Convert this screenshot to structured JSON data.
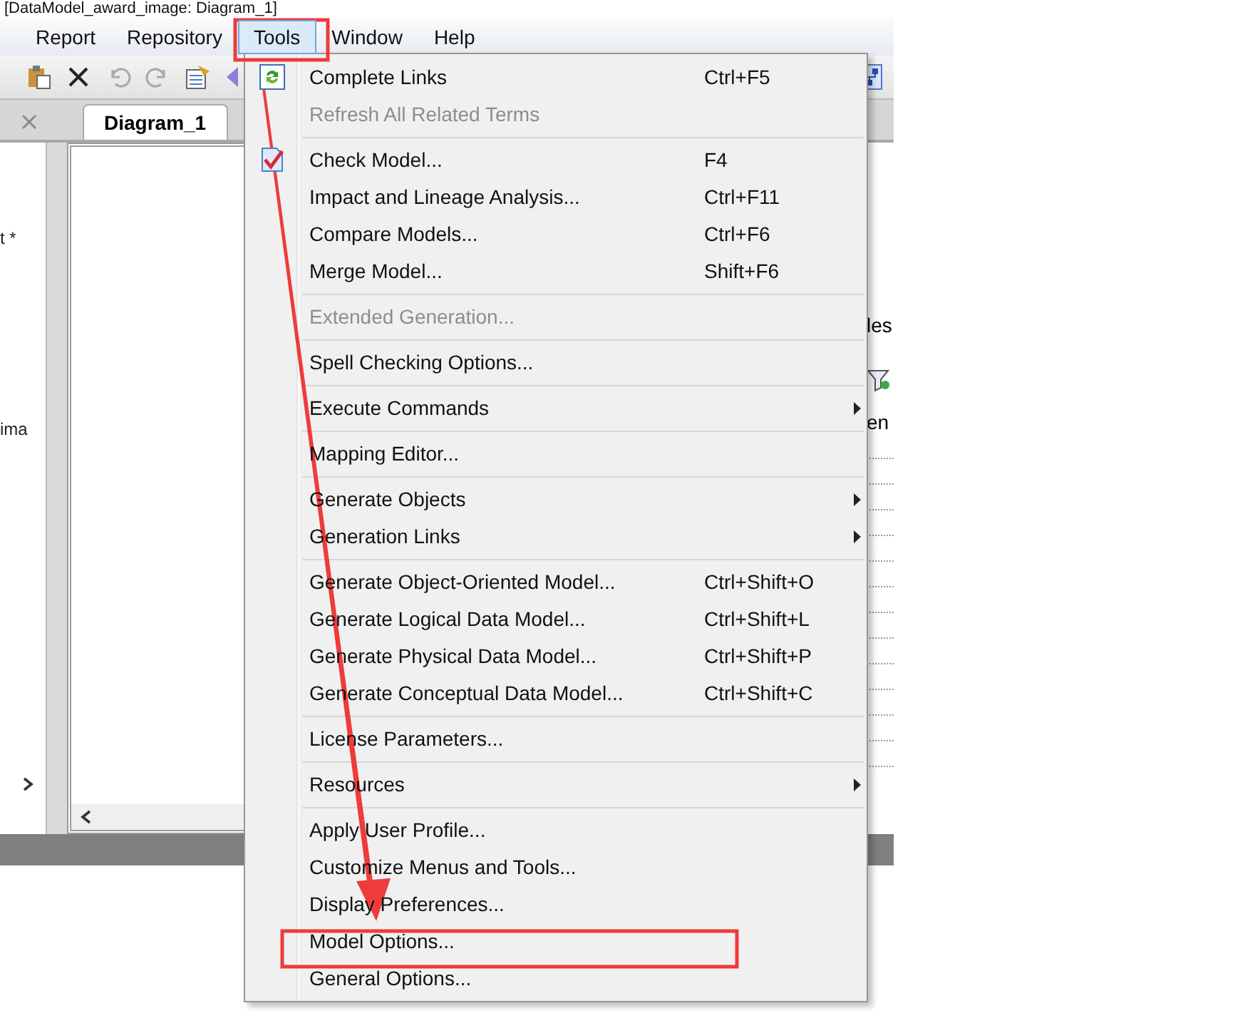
{
  "window": {
    "title": "[DataModel_award_image: Diagram_1]"
  },
  "menu_bar": [
    {
      "label": "Report",
      "selected": false
    },
    {
      "label": "Repository",
      "selected": false
    },
    {
      "label": "Tools",
      "selected": true
    },
    {
      "label": "Window",
      "selected": false
    },
    {
      "label": "Help",
      "selected": false
    }
  ],
  "tabs": [
    {
      "label": "Diagram_1",
      "selected": true
    }
  ],
  "browser_pane": {
    "items": [
      "t *",
      "ima"
    ]
  },
  "right_pane": {
    "texts": [
      "les",
      "en"
    ]
  },
  "tools_menu": {
    "items": [
      {
        "kind": "iconitem",
        "label": "Complete Links",
        "shortcut": "Ctrl+F5",
        "disabled": false,
        "submenu": false
      },
      {
        "kind": "item",
        "label": "Refresh All Related Terms",
        "disabled": true,
        "submenu": false
      },
      {
        "kind": "separator"
      },
      {
        "kind": "iconitem",
        "label": "Check Model...",
        "shortcut": "F4",
        "disabled": false,
        "submenu": false
      },
      {
        "kind": "item",
        "label": "Impact and Lineage Analysis...",
        "shortcut": "Ctrl+F11",
        "disabled": false,
        "submenu": false
      },
      {
        "kind": "item",
        "label": "Compare Models...",
        "shortcut": "Ctrl+F6",
        "disabled": false,
        "submenu": false
      },
      {
        "kind": "item",
        "label": "Merge Model...",
        "shortcut": "Shift+F6",
        "disabled": false,
        "submenu": false
      },
      {
        "kind": "separator"
      },
      {
        "kind": "item",
        "label": "Extended Generation...",
        "disabled": true,
        "submenu": false
      },
      {
        "kind": "separator"
      },
      {
        "kind": "item",
        "label": "Spell Checking Options...",
        "disabled": false,
        "submenu": false
      },
      {
        "kind": "separator"
      },
      {
        "kind": "item",
        "label": "Execute Commands",
        "disabled": false,
        "submenu": true
      },
      {
        "kind": "separator"
      },
      {
        "kind": "item",
        "label": "Mapping Editor...",
        "disabled": false,
        "submenu": false
      },
      {
        "kind": "separator"
      },
      {
        "kind": "item",
        "label": "Generate Objects",
        "disabled": false,
        "submenu": true
      },
      {
        "kind": "item",
        "label": "Generation Links",
        "disabled": false,
        "submenu": true
      },
      {
        "kind": "separator"
      },
      {
        "kind": "item",
        "label": "Generate Object-Oriented Model...",
        "shortcut": "Ctrl+Shift+O",
        "disabled": false,
        "submenu": false
      },
      {
        "kind": "item",
        "label": "Generate Logical Data Model...",
        "shortcut": "Ctrl+Shift+L",
        "disabled": false,
        "submenu": false
      },
      {
        "kind": "item",
        "label": "Generate Physical Data Model...",
        "shortcut": "Ctrl+Shift+P",
        "disabled": false,
        "submenu": false
      },
      {
        "kind": "item",
        "label": "Generate Conceptual Data Model...",
        "shortcut": "Ctrl+Shift+C",
        "disabled": false,
        "submenu": false
      },
      {
        "kind": "separator"
      },
      {
        "kind": "item",
        "label": "License Parameters...",
        "disabled": false,
        "submenu": false
      },
      {
        "kind": "separator"
      },
      {
        "kind": "item",
        "label": "Resources",
        "disabled": false,
        "submenu": true
      },
      {
        "kind": "separator"
      },
      {
        "kind": "item",
        "label": "Apply User Profile...",
        "disabled": false,
        "submenu": false
      },
      {
        "kind": "item",
        "label": "Customize Menus and Tools...",
        "disabled": false,
        "submenu": false
      },
      {
        "kind": "item",
        "label": "Display Preferences...",
        "disabled": false,
        "submenu": false
      },
      {
        "kind": "item",
        "label": "Model Options...",
        "disabled": false,
        "submenu": false
      },
      {
        "kind": "item",
        "label": "General Options...",
        "disabled": false,
        "submenu": false
      }
    ]
  }
}
